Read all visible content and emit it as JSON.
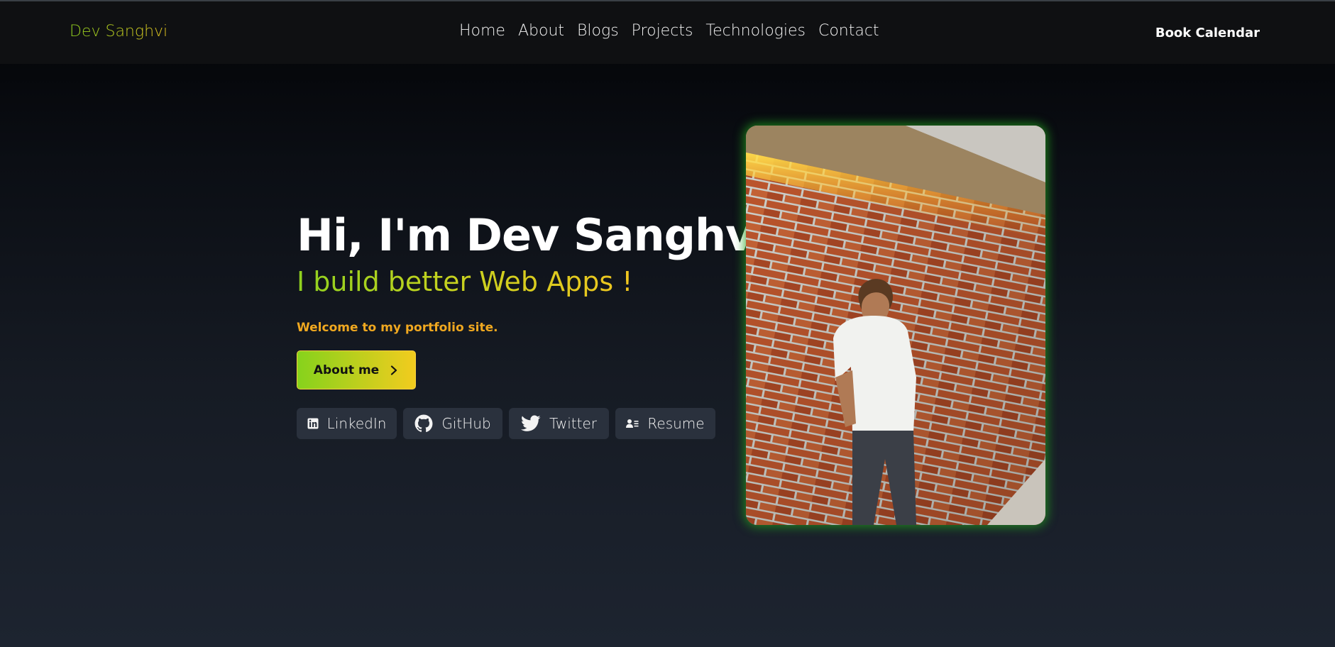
{
  "nav": {
    "brand": "Dev Sanghvi",
    "links": [
      "Home",
      "About",
      "Blogs",
      "Projects",
      "Technologies",
      "Contact"
    ],
    "cta": "Book Calendar"
  },
  "hero": {
    "title": "Hi, I'm Dev Sanghvi",
    "subtitle": "I build better Web Apps !",
    "welcome": "Welcome to my portfolio site.",
    "about_button": "About me",
    "socials": [
      {
        "label": "LinkedIn",
        "icon": "linkedin-icon"
      },
      {
        "label": "GitHub",
        "icon": "github-icon"
      },
      {
        "label": "Twitter",
        "icon": "twitter-icon"
      },
      {
        "label": "Resume",
        "icon": "resume-icon"
      }
    ]
  },
  "colors": {
    "accent_green": "#8fd11f",
    "accent_yellow": "#f0c51f",
    "welcome_orange": "#f0a820",
    "social_bg": "#2a313d",
    "photo_glow": "#22a01e"
  }
}
